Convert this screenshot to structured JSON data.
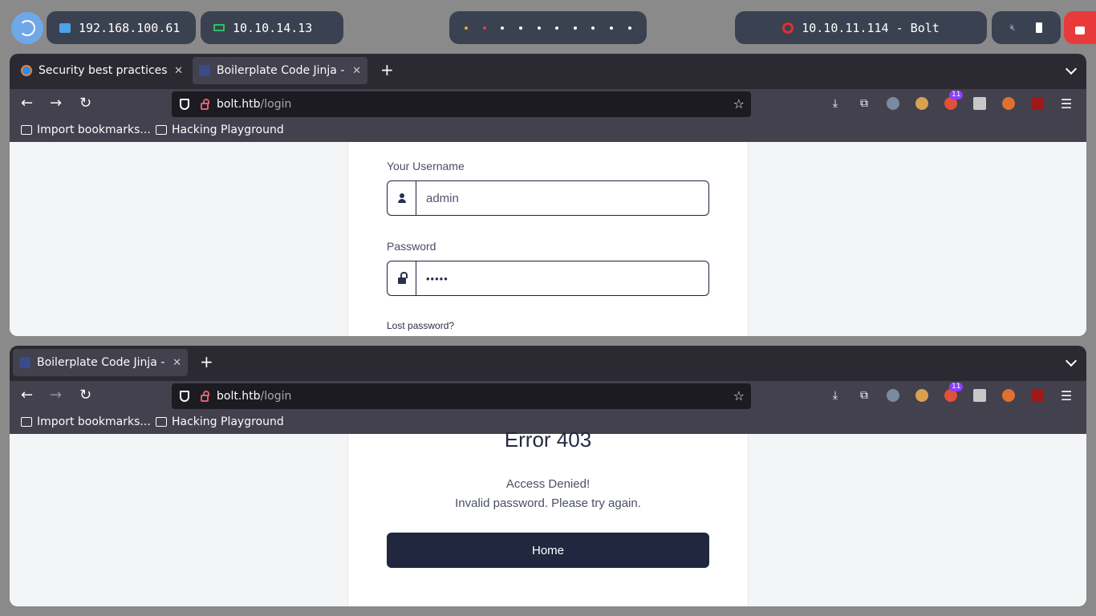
{
  "panel": {
    "local_ip": "192.168.100.61",
    "vpn_ip": "10.10.14.13",
    "target": "10.10.11.114 - Bolt",
    "workspaces": [
      "y",
      "r",
      "w",
      "w",
      "w",
      "w",
      "w",
      "w",
      "w",
      "w"
    ]
  },
  "colors": {
    "accent": "#6fa8e8",
    "lock": "#e83a3a",
    "button": "#20273f"
  },
  "window_top": {
    "tabs": [
      {
        "title": "Security best practices | ",
        "favicon": "firefox-icon",
        "active": false
      },
      {
        "title": "Boilerplate Code Jinja - S",
        "favicon": "boilerplate-icon",
        "active": true
      }
    ],
    "url_host": "bolt.htb",
    "url_path": "/login",
    "bookmarks": [
      "Import bookmarks...",
      "Hacking Playground"
    ],
    "form": {
      "username_label": "Your Username",
      "username_value": "admin",
      "password_label": "Password",
      "password_value": "•••••",
      "lost_password": "Lost password?"
    }
  },
  "window_bottom": {
    "tabs": [
      {
        "title": "Boilerplate Code Jinja - E",
        "favicon": "boilerplate-icon",
        "active": true
      }
    ],
    "url_host": "bolt.htb",
    "url_path": "/login",
    "bookmarks": [
      "Import bookmarks...",
      "Hacking Playground"
    ],
    "error": {
      "title": "Error 403",
      "line1": "Access Denied!",
      "line2": "Invalid password. Please try again.",
      "home_button": "Home"
    }
  },
  "toolbar": {
    "extension_badge": "11",
    "icons": [
      "downloads-icon",
      "extensions-icon",
      "spy-glasses-icon",
      "cookie-icon",
      "badge-extension-icon",
      "shield-ext-icon",
      "wappalyzer-icon",
      "ublock-icon",
      "hamburger-menu-icon"
    ]
  }
}
